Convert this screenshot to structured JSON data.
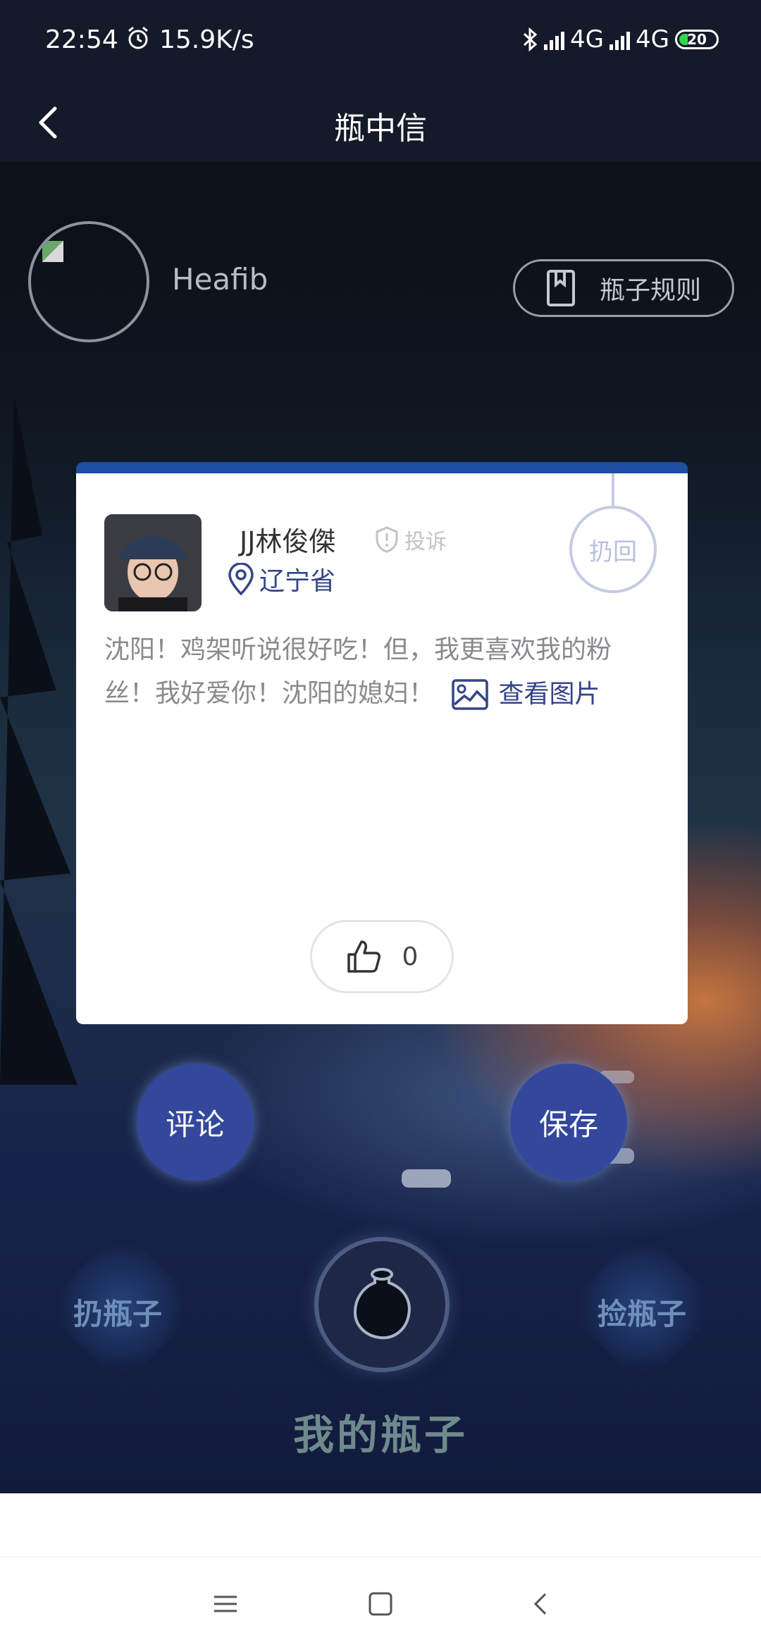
{
  "status_bar": {
    "time": "22:54",
    "speed": "15.9K/s",
    "net1": "4G",
    "net2": "4G",
    "battery": "20"
  },
  "nav": {
    "title": "瓶中信"
  },
  "profile": {
    "username": "Heafib",
    "rules_label": "瓶子规则"
  },
  "card": {
    "poster_name": "JJ林俊傑",
    "report_label": "投诉",
    "location": "辽宁省",
    "recall_label": "扔回",
    "message": "沈阳！鸡架听说很好吃！但，我更喜欢我的粉丝！我好爱你！沈阳的媳妇！",
    "view_image_label": "查看图片",
    "likes": "0"
  },
  "actions": {
    "comment": "评论",
    "save": "保存"
  },
  "bottom": {
    "throw": "扔瓶子",
    "pick": "捡瓶子",
    "my_bottles": "我的瓶子"
  },
  "colors": {
    "accent": "#33489c",
    "card_top": "#1e4fa0",
    "link": "#34448a"
  }
}
